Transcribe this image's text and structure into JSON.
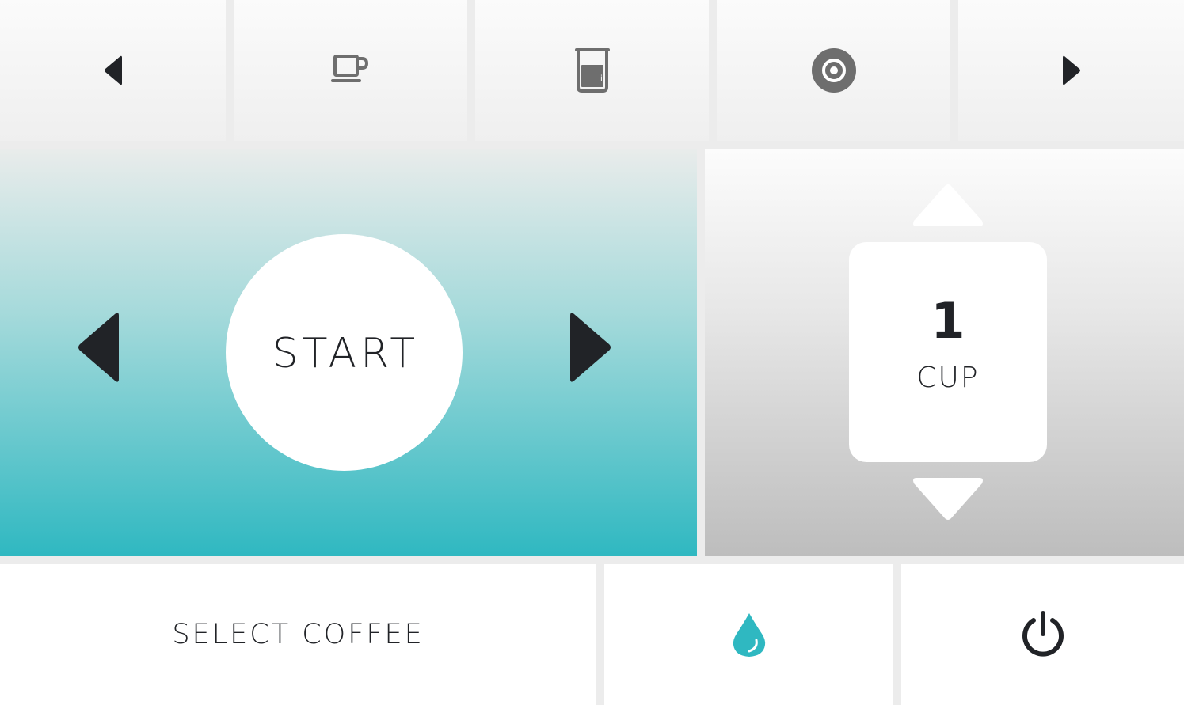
{
  "top_bar": {
    "items": [
      {
        "icon": "chevron-left-icon",
        "color": "#212327"
      },
      {
        "icon": "coffee-cup-icon",
        "color": "#6e6e6e"
      },
      {
        "icon": "water-tank-icon",
        "color": "#6e6e6e"
      },
      {
        "icon": "bean-container-icon",
        "color": "#6e6e6e"
      },
      {
        "icon": "chevron-right-icon",
        "color": "#212327"
      }
    ]
  },
  "main": {
    "start_label": "START",
    "accent_color": "#2fb8c1"
  },
  "cup_selector": {
    "count": "1",
    "unit": "CUP"
  },
  "bottom_bar": {
    "select_label": "SELECT COFFEE",
    "water_icon": "water-drop-icon",
    "water_color": "#2fb8c1",
    "power_icon": "power-icon"
  }
}
